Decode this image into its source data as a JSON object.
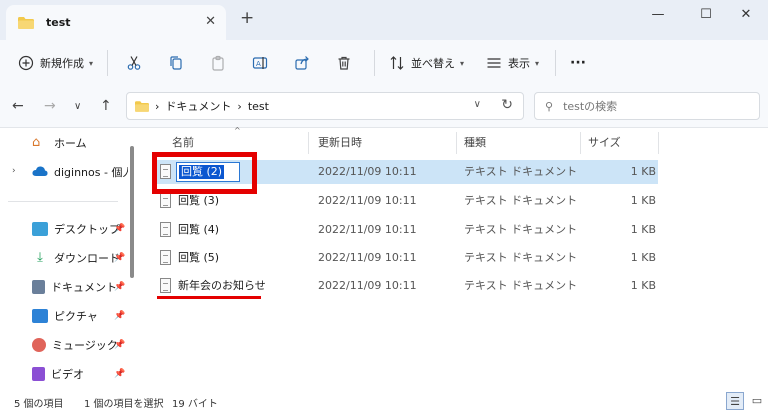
{
  "window": {
    "tab_title": "test",
    "new_tab": "+",
    "close_tab": "✕",
    "minimize": "—",
    "maximize": "☐",
    "close": "✕"
  },
  "toolbar": {
    "new_label": "新規作成",
    "sort_label": "並べ替え",
    "view_label": "表示",
    "more": "···"
  },
  "address": {
    "segments": [
      "ドキュメント",
      "test"
    ],
    "search_placeholder": "testの検索"
  },
  "sidebar": {
    "items": [
      {
        "label": "ホーム",
        "pinned": false
      },
      {
        "label": "diginnos - 個人用",
        "pinned": false
      },
      {
        "label": "デスクトップ",
        "pinned": true
      },
      {
        "label": "ダウンロード",
        "pinned": true
      },
      {
        "label": "ドキュメント",
        "pinned": true
      },
      {
        "label": "ピクチャ",
        "pinned": true
      },
      {
        "label": "ミュージック",
        "pinned": true
      },
      {
        "label": "ビデオ",
        "pinned": true
      }
    ]
  },
  "columns": {
    "name": "名前",
    "date": "更新日時",
    "type": "種類",
    "size": "サイズ"
  },
  "files": [
    {
      "name": "回覧 (2)",
      "date": "2022/11/09 10:11",
      "type": "テキスト ドキュメント",
      "size": "1 KB",
      "renaming": true
    },
    {
      "name": "回覧 (3)",
      "date": "2022/11/09 10:11",
      "type": "テキスト ドキュメント",
      "size": "1 KB"
    },
    {
      "name": "回覧 (4)",
      "date": "2022/11/09 10:11",
      "type": "テキスト ドキュメント",
      "size": "1 KB"
    },
    {
      "name": "回覧 (5)",
      "date": "2022/11/09 10:11",
      "type": "テキスト ドキュメント",
      "size": "1 KB"
    },
    {
      "name": "新年会のお知らせ",
      "date": "2022/11/09 10:11",
      "type": "テキスト ドキュメント",
      "size": "1 KB"
    }
  ],
  "status": {
    "count": "5 個の項目",
    "selection": "1 個の項目を選択",
    "size": "19 バイト"
  },
  "colors": {
    "annotation": "#e40000",
    "selection": "#cce4f7",
    "folder": "#f2c94c"
  }
}
